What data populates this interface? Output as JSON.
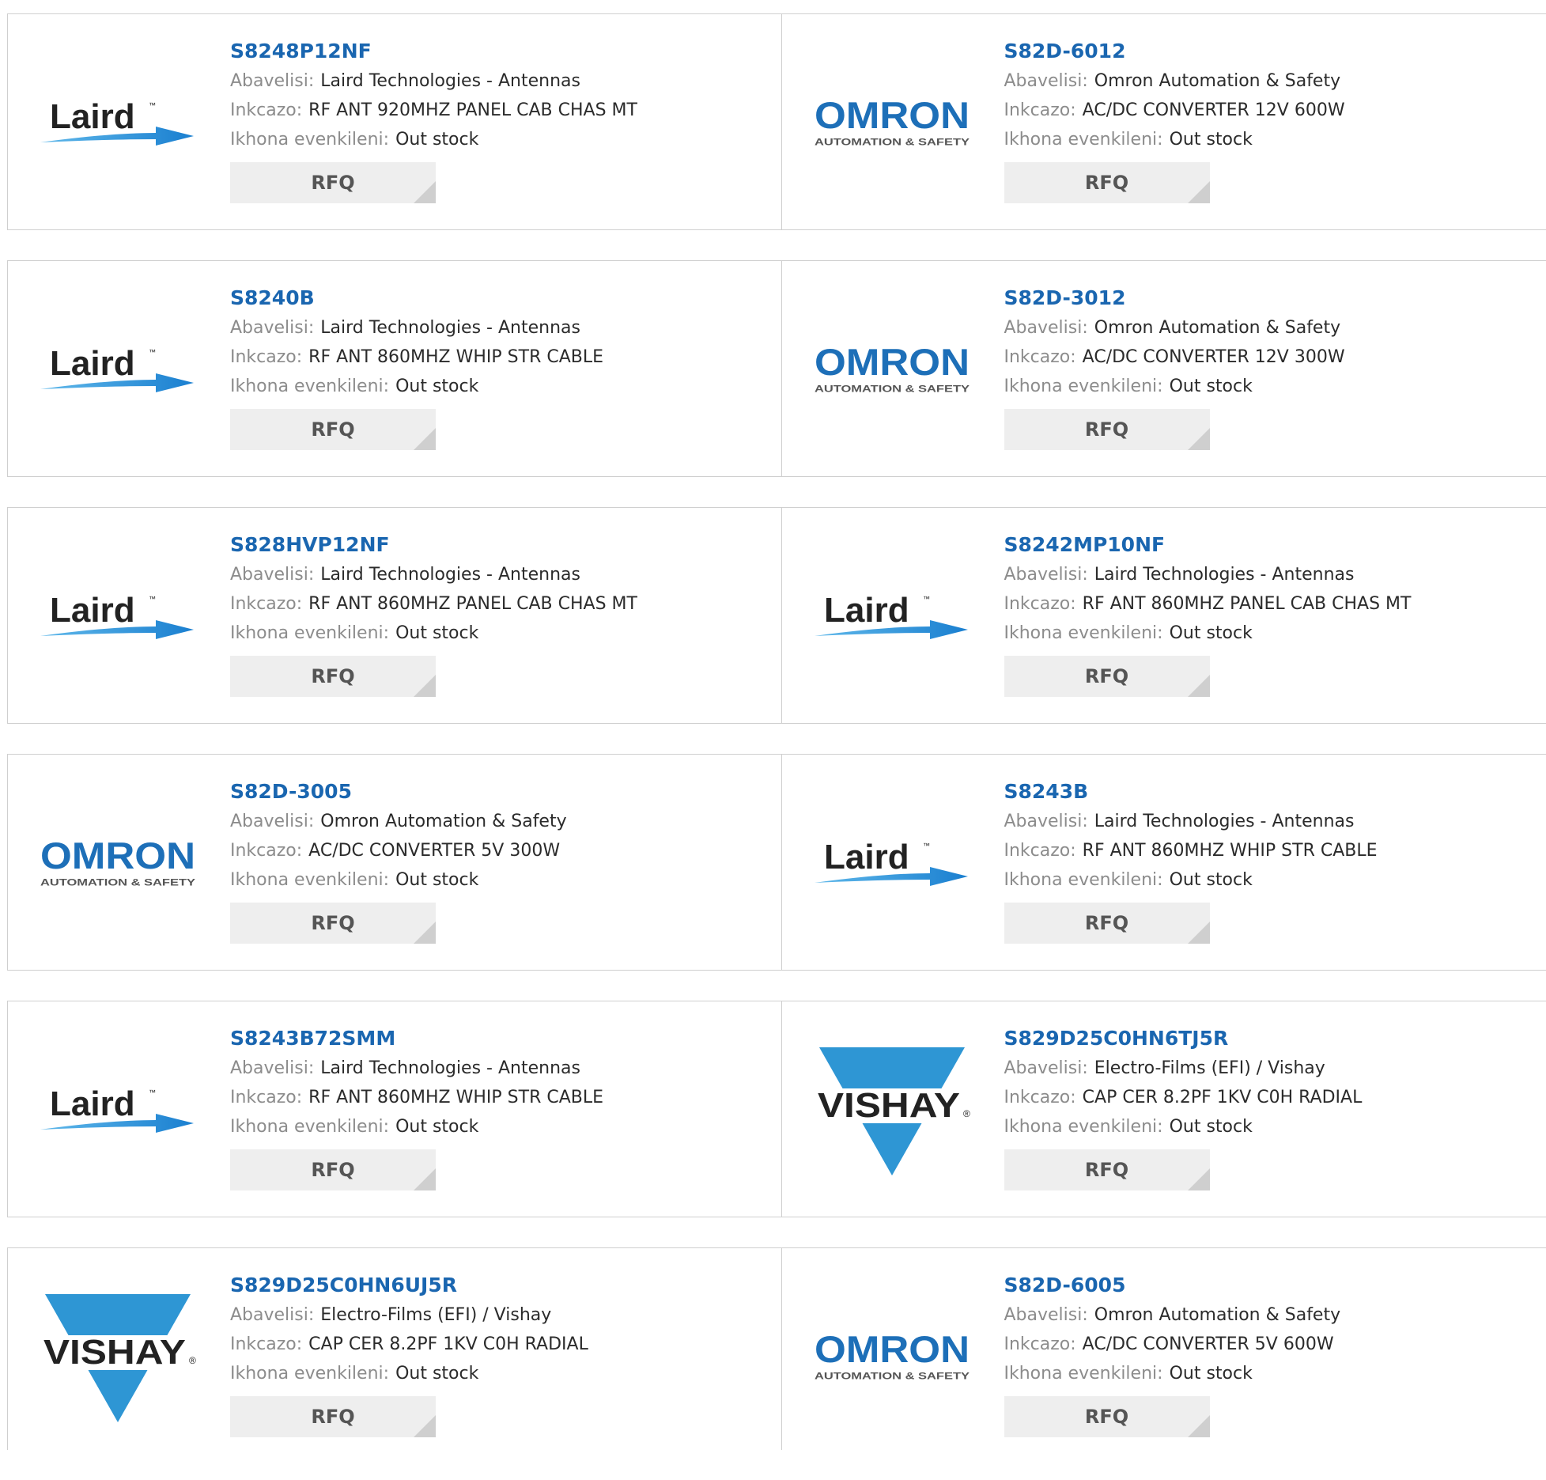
{
  "labels": {
    "manufacturer": "Abavelisi:",
    "description": "Inkcazo:",
    "stock": "Ikhona evenkileni:",
    "rfq": "RFQ"
  },
  "colors": {
    "part_link": "#1a66b0",
    "laird_blue": "#1e8fd8",
    "omron_blue": "#1d6fb8",
    "vishay_blue": "#2e96d4"
  },
  "logos": {
    "laird": {
      "text": "Laird",
      "tm": "™"
    },
    "omron": {
      "text": "OMRON",
      "sub": "AUTOMATION & SAFETY"
    },
    "vishay": {
      "text": "VISHAY",
      "reg": "®"
    }
  },
  "products": [
    {
      "logo": "laird",
      "part": "S8248P12NF",
      "manufacturer": "Laird Technologies - Antennas",
      "description": "RF ANT 920MHZ PANEL CAB CHAS MT",
      "stock": "Out stock"
    },
    {
      "logo": "omron",
      "part": "S82D-6012",
      "manufacturer": "Omron Automation & Safety",
      "description": "AC/DC CONVERTER 12V 600W",
      "stock": "Out stock"
    },
    {
      "logo": "laird",
      "part": "S8240B",
      "manufacturer": "Laird Technologies - Antennas",
      "description": "RF ANT 860MHZ WHIP STR CABLE",
      "stock": "Out stock"
    },
    {
      "logo": "omron",
      "part": "S82D-3012",
      "manufacturer": "Omron Automation & Safety",
      "description": "AC/DC CONVERTER 12V 300W",
      "stock": "Out stock"
    },
    {
      "logo": "laird",
      "part": "S828HVP12NF",
      "manufacturer": "Laird Technologies - Antennas",
      "description": "RF ANT 860MHZ PANEL CAB CHAS MT",
      "stock": "Out stock"
    },
    {
      "logo": "laird",
      "part": "S8242MP10NF",
      "manufacturer": "Laird Technologies - Antennas",
      "description": "RF ANT 860MHZ PANEL CAB CHAS MT",
      "stock": "Out stock"
    },
    {
      "logo": "omron",
      "part": "S82D-3005",
      "manufacturer": "Omron Automation & Safety",
      "description": "AC/DC CONVERTER 5V 300W",
      "stock": "Out stock"
    },
    {
      "logo": "laird",
      "part": "S8243B",
      "manufacturer": "Laird Technologies - Antennas",
      "description": "RF ANT 860MHZ WHIP STR CABLE",
      "stock": "Out stock"
    },
    {
      "logo": "laird",
      "part": "S8243B72SMM",
      "manufacturer": "Laird Technologies - Antennas",
      "description": "RF ANT 860MHZ WHIP STR CABLE",
      "stock": "Out stock"
    },
    {
      "logo": "vishay",
      "part": "S829D25C0HN6TJ5R",
      "manufacturer": "Electro-Films (EFI) / Vishay",
      "description": "CAP CER 8.2PF 1KV C0H RADIAL",
      "stock": "Out stock"
    },
    {
      "logo": "vishay",
      "part": "S829D25C0HN6UJ5R",
      "manufacturer": "Electro-Films (EFI) / Vishay",
      "description": "CAP CER 8.2PF 1KV C0H RADIAL",
      "stock": "Out stock"
    },
    {
      "logo": "omron",
      "part": "S82D-6005",
      "manufacturer": "Omron Automation & Safety",
      "description": "AC/DC CONVERTER 5V 600W",
      "stock": "Out stock"
    }
  ]
}
